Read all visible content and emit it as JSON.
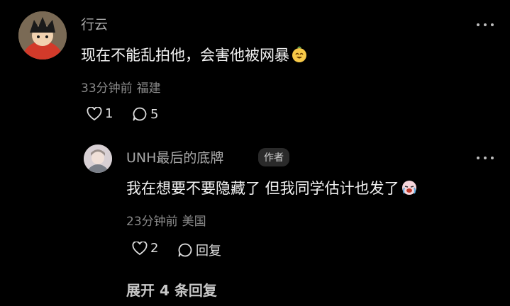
{
  "comment": {
    "username": "行云",
    "text": "现在不能乱拍他，会害他被网暴",
    "time": "33分钟前",
    "location": "福建",
    "likes": "1",
    "replies": "5"
  },
  "reply": {
    "username": "UNH最后的底牌",
    "badge": "作者",
    "text": "我在想要不要隐藏了 但我同学估计也发了",
    "time": "23分钟前",
    "location": "美国",
    "likes": "2",
    "reply_label": "回复"
  },
  "expand_label": "展开 4 条回复"
}
